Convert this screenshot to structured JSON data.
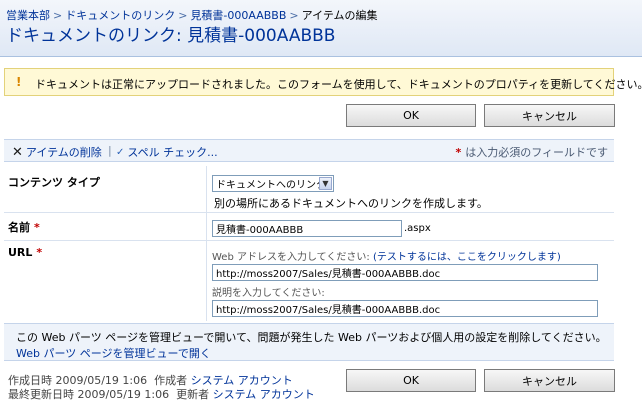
{
  "breadcrumb": {
    "items": [
      "営業本部",
      "ドキュメントのリンク",
      "見積書-000AABBB"
    ],
    "current": "アイテムの編集",
    "separator": ">"
  },
  "page_title": "ドキュメントのリンク: 見積書-000AABBB",
  "message": {
    "icon": "warning-icon",
    "text": "ドキュメントは正常にアップロードされました。このフォームを使用して、ドキュメントのプロパティを更新してください。"
  },
  "buttons": {
    "ok": "OK",
    "cancel": "キャンセル"
  },
  "toolbar": {
    "delete_item": "アイテムの削除",
    "divider": "|",
    "spell_check": "スペル チェック...",
    "required_asterisk": "*",
    "required_note": "は入力必須のフィールドです"
  },
  "form": {
    "content_type": {
      "label": "コンテンツ タイプ",
      "selected": "ドキュメントへのリンク",
      "description": "別の場所にあるドキュメントへのリンクを作成します。"
    },
    "name": {
      "label": "名前",
      "required": "*",
      "value": "見積書-000AABBB",
      "suffix": ".aspx"
    },
    "url": {
      "label": "URL",
      "required": "*",
      "address_hint": "Web アドレスを入力してください:",
      "test_link": "(テストするには、ここをクリックします)",
      "address_value": "http://moss2007/Sales/見積書-000AABBB.doc",
      "description_hint": "説明を入力してください:",
      "description_value": "http://moss2007/Sales/見積書-000AABBB.doc"
    }
  },
  "footer_note": {
    "line1": "この Web パーツ ページを管理ビューで開いて、問題が発生した Web パーツおよび個人用の設定を削除してください。",
    "link": "Web パーツ ページを管理ビューで開く"
  },
  "audit": {
    "created_label": "作成日時",
    "created_at": "2009/05/19 1:06",
    "created_by_label": "作成者",
    "created_by": "システム アカウント",
    "modified_label": "最終更新日時",
    "modified_at": "2009/05/19 1:06",
    "modified_by_label": "更新者",
    "modified_by": "システム アカウント"
  }
}
